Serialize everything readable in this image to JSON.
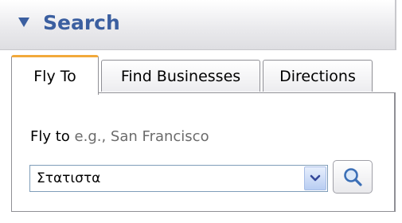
{
  "panel": {
    "title": "Search",
    "collapse_icon": "triangle-down-icon"
  },
  "tabs": [
    {
      "label": "Fly To",
      "active": true
    },
    {
      "label": "Find Businesses",
      "active": false
    },
    {
      "label": "Directions",
      "active": false
    }
  ],
  "fly_to": {
    "label": "Fly to",
    "hint": "e.g., San Francisco",
    "input_value": "Στατιστα",
    "dropdown_icon": "chevron-down-icon",
    "search_icon": "magnifier-icon"
  },
  "colors": {
    "title": "#3b5fa0",
    "active_tab_accent": "#f2a93b",
    "hint_text": "#6b6b6b"
  }
}
